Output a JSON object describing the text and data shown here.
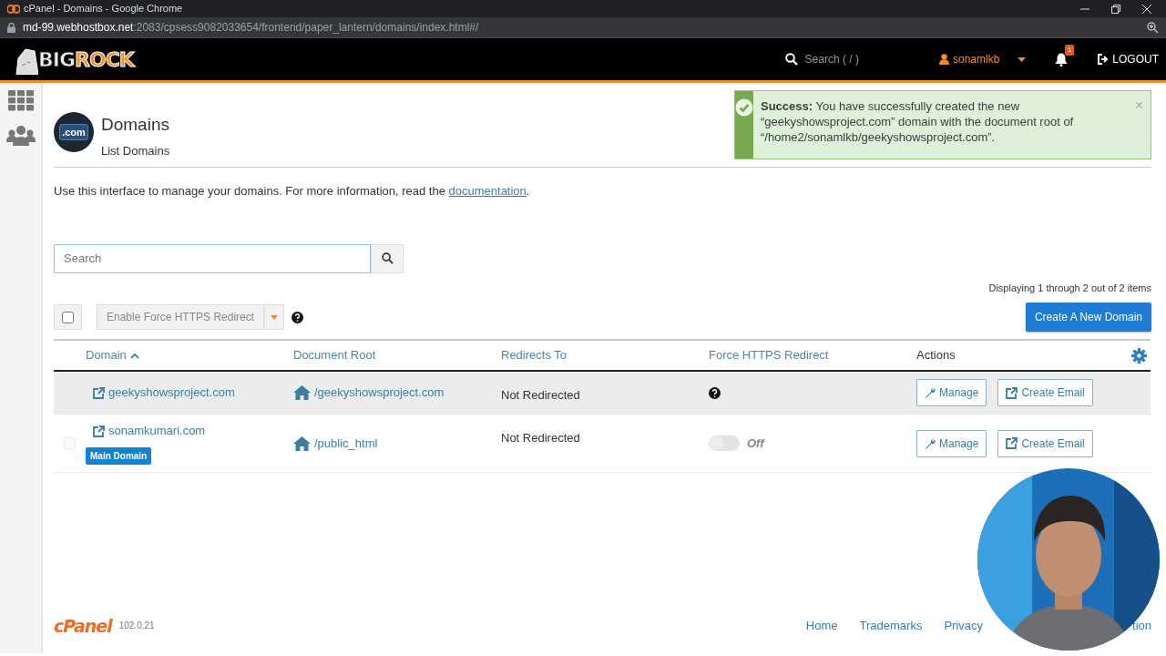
{
  "browser": {
    "title": "cPanel - Domains - Google Chrome",
    "url_host": "md-99.webhostbox.net",
    "url_path": ":2083/cpsess9082033654/frontend/paper_lantern/domains/index.html#/"
  },
  "header": {
    "logo_dark": "BIG",
    "logo_bright": "ROCK",
    "search_placeholder": "Search ( / )",
    "user": "sonamlkb",
    "notifications": "1",
    "logout": "LOGOUT"
  },
  "alert": {
    "kind": "success",
    "title": "Success:",
    "message": "You have successfully created the new “geekyshowsproject.com” domain with the document root of “/home2/sonamlkb/geekyshowsproject.com”.",
    "close": "×"
  },
  "page": {
    "icon_text": ".com",
    "title": "Domains",
    "subtitle": "List Domains",
    "intro": "Use this interface to manage your domains. For more information, read the ",
    "intro_link": "documentation",
    "intro_end": "."
  },
  "search": {
    "placeholder": "Search"
  },
  "count": "Displaying 1 through 2 out of 2 items",
  "select_all": {
    "checked": false
  },
  "bulk_button": {
    "label": "Enable Force HTTPS Redirect",
    "disabled": true
  },
  "create_button": "Create A New Domain",
  "columns": [
    {
      "label": "Domain",
      "sorted": true
    },
    {
      "label": "Document Root",
      "sorted": false
    },
    {
      "label": "Redirects To",
      "sorted": false
    },
    {
      "label": "Force HTTPS Redirect",
      "sorted": false
    },
    {
      "label": "Actions",
      "sorted": false
    }
  ],
  "rows": [
    {
      "domain": "geekyshowsproject.com",
      "document_root": "/geekyshowsproject.com",
      "redirects": "Not Redirected",
      "https": {
        "kind": "help"
      },
      "actions": [
        "Manage",
        "Create Email"
      ],
      "highlighted": true
    },
    {
      "domain": "sonamkumari.com",
      "badge": "Main Domain",
      "document_root": "/public_html",
      "redirects": "Not Redirected",
      "https": {
        "kind": "toggle",
        "on": false,
        "label": "Off"
      },
      "actions": [
        "Manage",
        "Create Email"
      ],
      "highlighted": false,
      "checkbox": {
        "checked": false,
        "disabled": true
      }
    }
  ],
  "footer": {
    "logo": "cPanel",
    "version": "102.0.21",
    "links": [
      "Home",
      "Trademarks",
      "Privacy",
      "tion"
    ]
  }
}
